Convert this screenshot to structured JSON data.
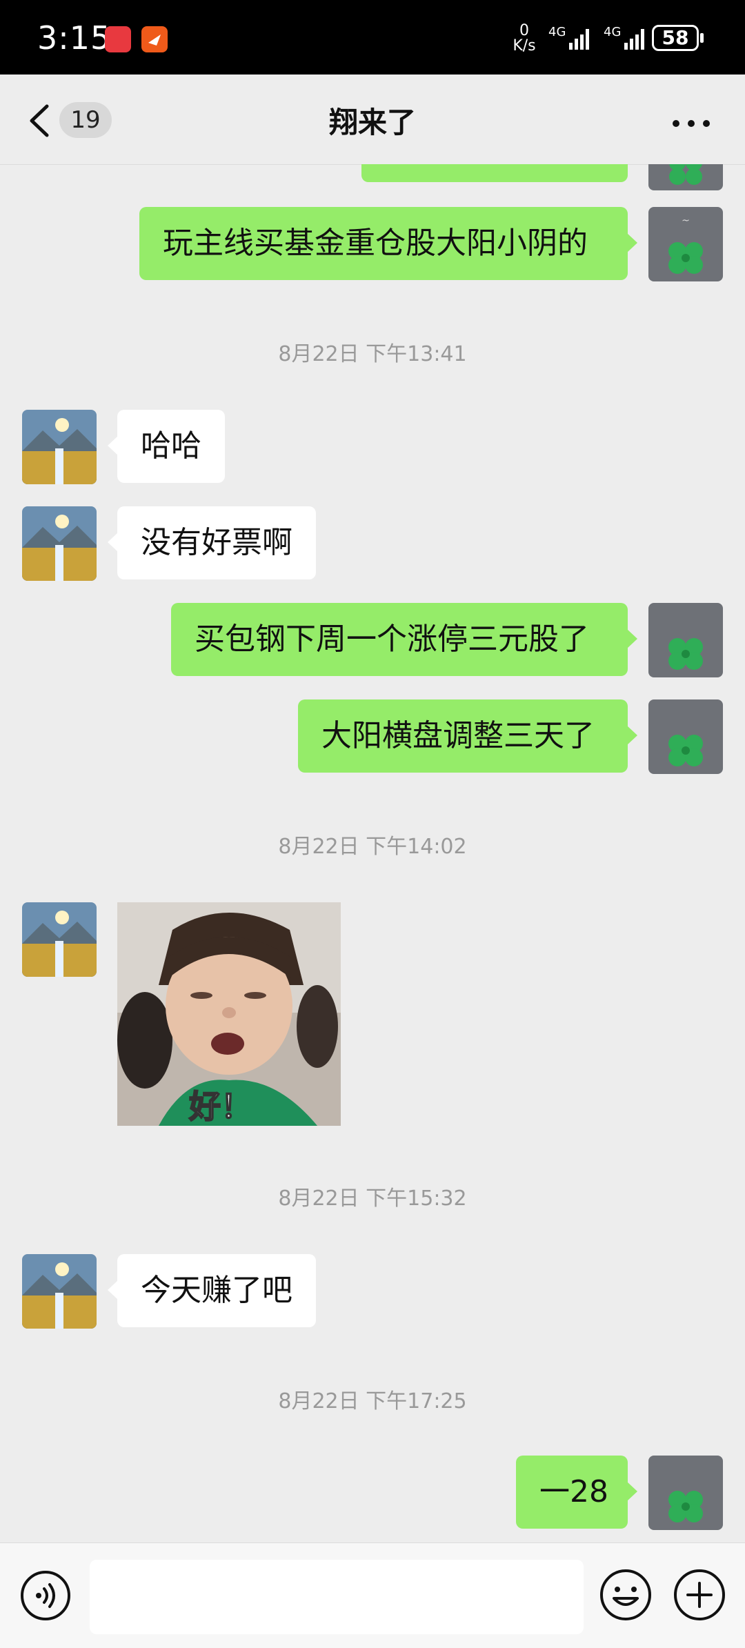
{
  "status_bar": {
    "time": "3:15",
    "net_speed_value": "0",
    "net_speed_unit": "K/s",
    "sim1": "4G",
    "sim2": "4G",
    "battery": "58",
    "app_icons": [
      "huawei-appgallery-icon",
      "app-notification-icon"
    ]
  },
  "header": {
    "unread_count": "19",
    "title": "翔来了",
    "more_icon": "more-icon"
  },
  "messages": [
    {
      "type": "text",
      "side": "out",
      "text": "玩主线买基金重仓股大阳小阴的"
    },
    {
      "type": "timestamp",
      "text": "8月22日 下午13:41"
    },
    {
      "type": "text",
      "side": "in",
      "text": "哈哈"
    },
    {
      "type": "text",
      "side": "in",
      "text": "没有好票啊"
    },
    {
      "type": "text",
      "side": "out",
      "text": "买包钢下周一个涨停三元股了"
    },
    {
      "type": "text",
      "side": "out",
      "text": "大阳横盘调整三天了"
    },
    {
      "type": "timestamp",
      "text": "8月22日 下午14:02"
    },
    {
      "type": "sticker",
      "side": "in",
      "caption": "好！"
    },
    {
      "type": "timestamp",
      "text": "8月22日 下午15:32"
    },
    {
      "type": "text",
      "side": "in",
      "text": "今天赚了吧"
    },
    {
      "type": "timestamp",
      "text": "8月22日 下午17:25"
    },
    {
      "type": "text",
      "side": "out",
      "text": "一28"
    }
  ],
  "input_bar": {
    "voice_icon": "voice-icon",
    "emoji_icon": "emoji-icon",
    "plus_icon": "plus-icon",
    "placeholder": ""
  },
  "colors": {
    "background": "#ededed",
    "outgoing_bubble": "#95ec69",
    "incoming_bubble": "#ffffff",
    "timestamp_text": "#999999"
  }
}
